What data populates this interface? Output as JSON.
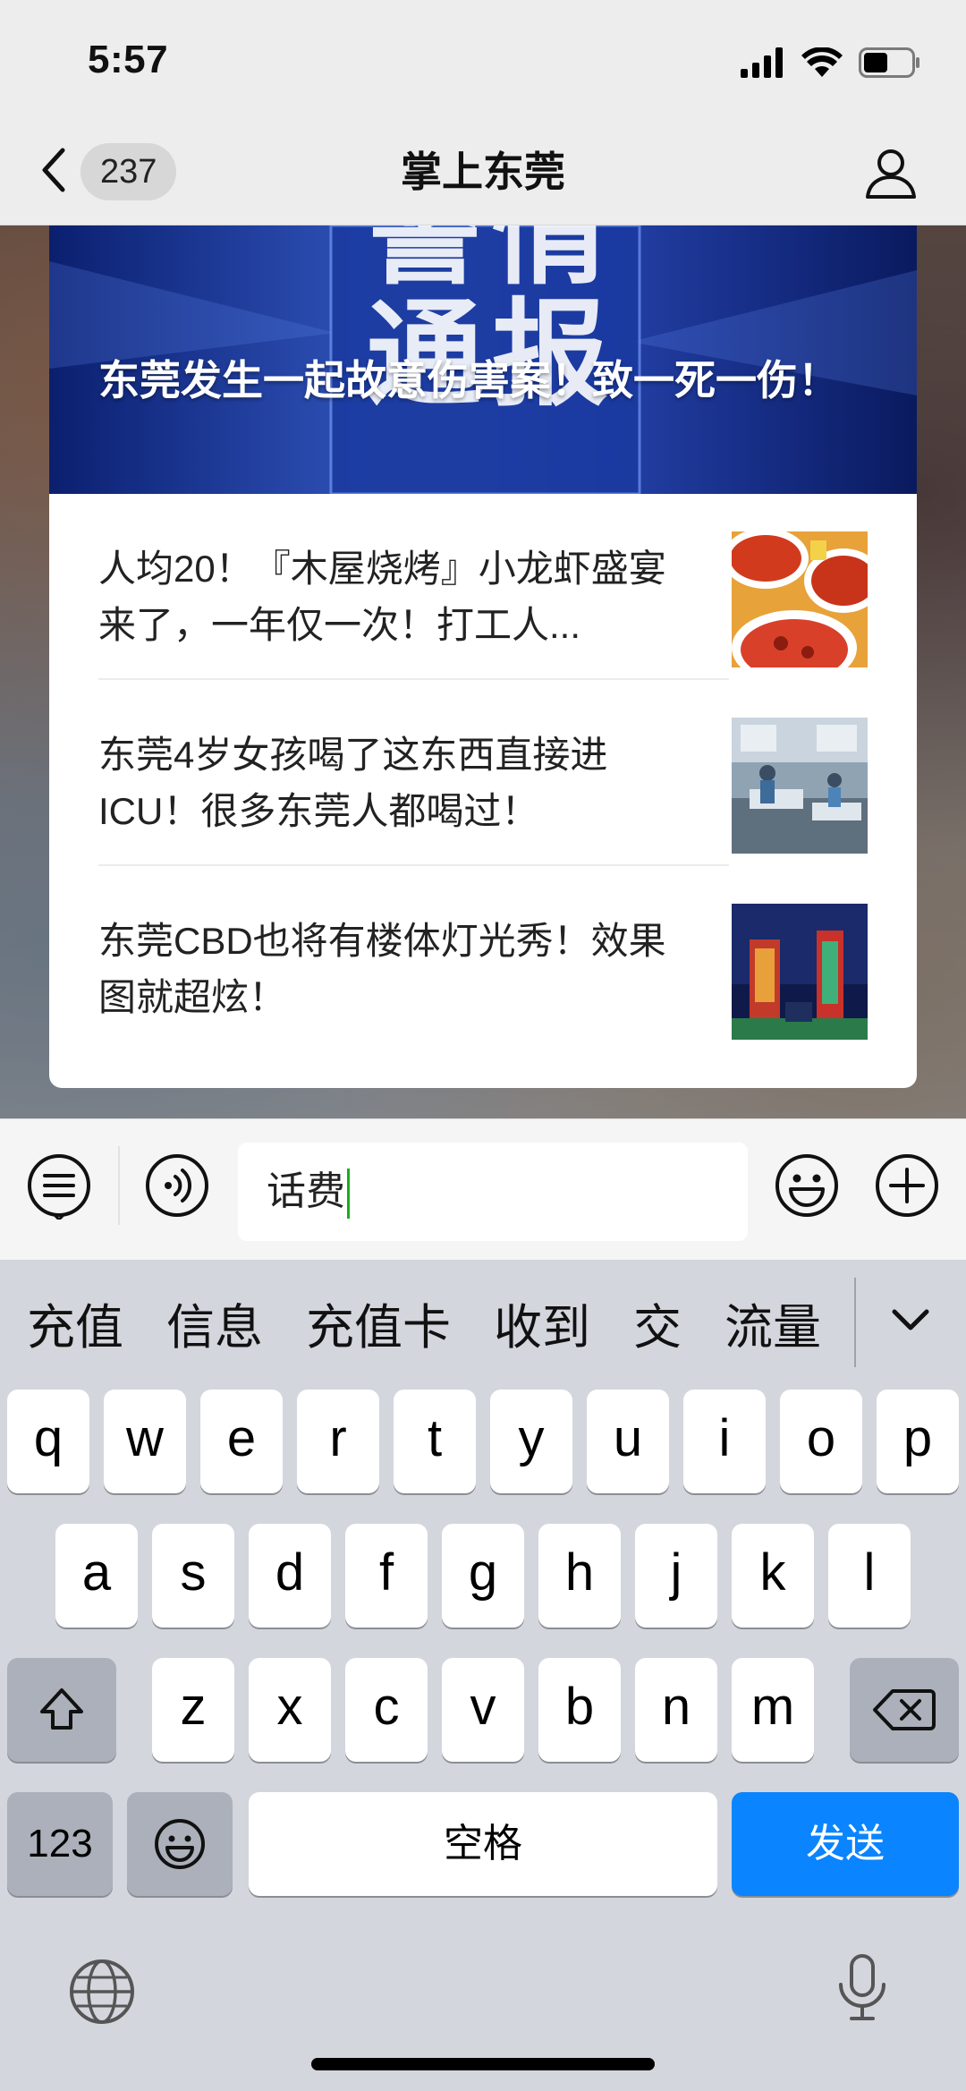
{
  "status_bar": {
    "time": "5:57"
  },
  "nav": {
    "unread_count": "237",
    "title": "掌上东莞"
  },
  "hero_article": {
    "title": "东莞发生一起故意伤害案！致一死一伤！",
    "banner_text": "警情通报"
  },
  "articles": [
    {
      "title": "人均20！『木屋烧烤』小龙虾盛宴来了，一年仅一次！打工人...",
      "thumb": "crayfish-photo"
    },
    {
      "title": "东莞4岁女孩喝了这东西直接进ICU！很多东莞人都喝过！",
      "thumb": "hospital-photo"
    },
    {
      "title": "东莞CBD也将有楼体灯光秀！效果图就超炫！",
      "thumb": "cbd-lights-photo"
    }
  ],
  "input": {
    "value": "话费"
  },
  "candidates": [
    "充值",
    "信息",
    "充值卡",
    "收到",
    "交",
    "流量"
  ],
  "keyboard": {
    "row1": [
      "q",
      "w",
      "e",
      "r",
      "t",
      "y",
      "u",
      "i",
      "o",
      "p"
    ],
    "row2": [
      "a",
      "s",
      "d",
      "f",
      "g",
      "h",
      "j",
      "k",
      "l"
    ],
    "row3": [
      "z",
      "x",
      "c",
      "v",
      "b",
      "n",
      "m"
    ],
    "numbers_label": "123",
    "space_label": "空格",
    "send_label": "发送"
  },
  "colors": {
    "send_key": "#0a84ff",
    "caret": "#1aad19",
    "hero_blue": "#1e3fa8"
  }
}
